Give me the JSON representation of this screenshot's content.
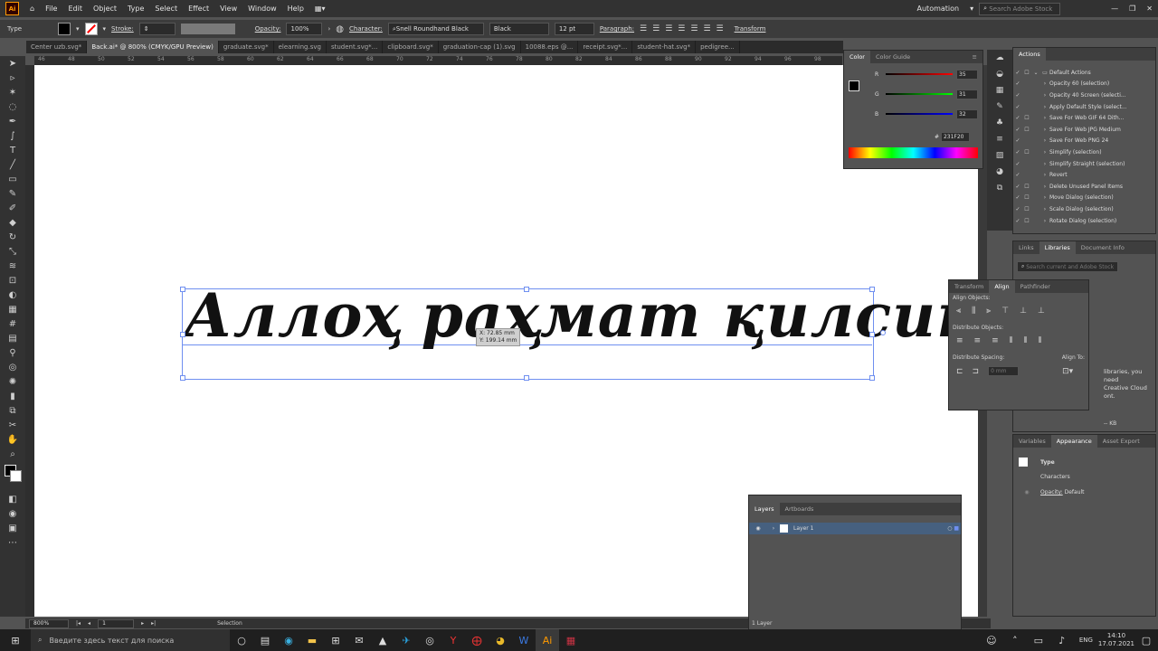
{
  "menubar": {
    "app_logo": "Ai",
    "items": [
      "File",
      "Edit",
      "Object",
      "Type",
      "Select",
      "Effect",
      "View",
      "Window",
      "Help"
    ],
    "workspace": "Automation",
    "search_placeholder": "Search Adobe Stock"
  },
  "controlbar": {
    "mode": "Type",
    "stroke_label": "Stroke:",
    "opacity_label": "Opacity:",
    "opacity_value": "100%",
    "character_label": "Character:",
    "font_family": "Snell Roundhand Black",
    "font_style": "Black",
    "font_size": "12 pt",
    "paragraph_label": "Paragraph:",
    "transform_label": "Transform"
  },
  "tabs": [
    {
      "label": "Center uzb.svg*",
      "active": false
    },
    {
      "label": "Back.ai* @ 800% (CMYK/GPU Preview)",
      "active": true
    },
    {
      "label": "graduate.svg*",
      "active": false
    },
    {
      "label": "elearning.svg",
      "active": false
    },
    {
      "label": "student.svg*...",
      "active": false
    },
    {
      "label": "clipboard.svg*",
      "active": false
    },
    {
      "label": "graduation-cap (1).svg",
      "active": false
    },
    {
      "label": "10088.eps @...",
      "active": false
    },
    {
      "label": "receipt.svg*...",
      "active": false
    },
    {
      "label": "student-hat.svg*",
      "active": false
    },
    {
      "label": "pedigree...",
      "active": false
    }
  ],
  "ruler": {
    "ticks": [
      "46",
      "48",
      "50",
      "52",
      "54",
      "56",
      "58",
      "60",
      "62",
      "64",
      "66",
      "68",
      "70",
      "72",
      "74",
      "76",
      "78",
      "80",
      "82",
      "84",
      "86",
      "88",
      "90",
      "92",
      "94",
      "96",
      "98"
    ]
  },
  "canvas": {
    "text": "Аллоҳ раҳмат қилсин",
    "tooltip_x": "X: 72.85 mm",
    "tooltip_y": "Y: 199.14 mm"
  },
  "statusbar": {
    "zoom": "800%",
    "artboard": "1",
    "tool": "Selection"
  },
  "color_panel": {
    "tabs": [
      "Color",
      "Color Guide"
    ],
    "r": "35",
    "g": "31",
    "b": "32",
    "r_label": "R",
    "g_label": "G",
    "b_label": "B",
    "hex": "231F20",
    "hex_symbol": "#"
  },
  "actions_panel": {
    "title": "Actions",
    "set": "Default Actions",
    "items": [
      "Opacity 60 (selection)",
      "Opacity 40 Screen (selecti...",
      "Apply Default Style (select...",
      "Save For Web GIF 64 Dith...",
      "Save For Web JPG Medium",
      "Save For Web PNG 24",
      "Simplify (selection)",
      "Simplify Straight (selection)",
      "Revert",
      "Delete Unused Panel Items",
      "Move Dialog (selection)",
      "Scale Dialog (selection)",
      "Rotate Dialog (selection)"
    ]
  },
  "libraries_panel": {
    "tabs": [
      "Links",
      "Libraries",
      "Document Info"
    ],
    "search_placeholder": "Search current and Adobe Stock",
    "msg1": "libraries, you need",
    "msg2": "Creative Cloud",
    "msg3": "ont.",
    "size": "-- KB"
  },
  "align_panel": {
    "tabs": [
      "Transform",
      "Align",
      "Pathfinder"
    ],
    "align_objects": "Align Objects:",
    "distribute_objects": "Distribute Objects:",
    "distribute_spacing": "Distribute Spacing:",
    "align_to": "Align To:",
    "spacing_value": "0 mm"
  },
  "appearance_panel": {
    "tabs": [
      "Variables",
      "Appearance",
      "Asset Export"
    ],
    "type": "Type",
    "characters": "Characters",
    "opacity_label": "Opacity:",
    "opacity_value": "Default"
  },
  "layers_panel": {
    "tabs": [
      "Layers",
      "Artboards"
    ],
    "layer_name": "Layer 1",
    "count": "1 Layer"
  },
  "taskbar": {
    "search_placeholder": "Введите здесь текст для поиска",
    "lang": "ENG",
    "time": "14:10",
    "date": "17.07.2021"
  },
  "colors": {
    "accent": "#6f8ff0",
    "layer_highlight": "#46607f"
  }
}
